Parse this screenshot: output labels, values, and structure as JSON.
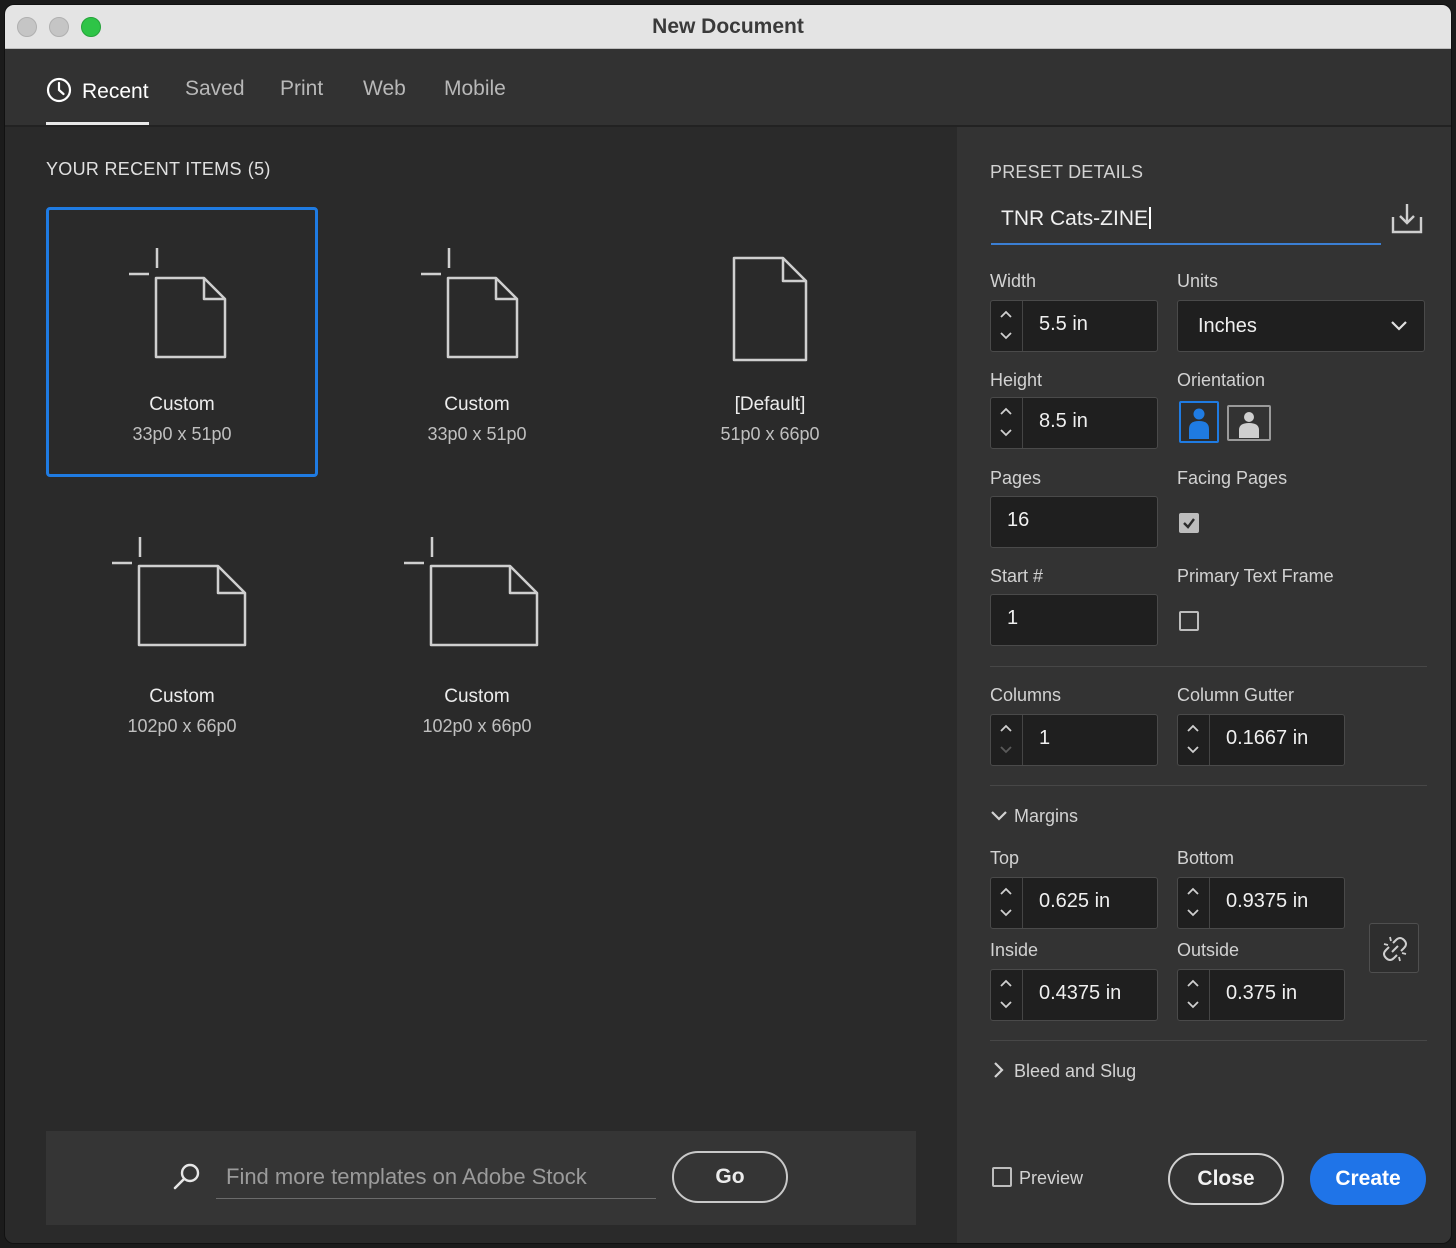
{
  "window": {
    "title": "New Document"
  },
  "tabs": [
    {
      "label": "Recent",
      "active": true,
      "icon": "clock-icon"
    },
    {
      "label": "Saved",
      "active": false
    },
    {
      "label": "Print",
      "active": false
    },
    {
      "label": "Web",
      "active": false
    },
    {
      "label": "Mobile",
      "active": false
    }
  ],
  "recent": {
    "heading": "YOUR RECENT ITEMS",
    "count": "(5)",
    "items": [
      {
        "name": "Custom",
        "dims": "33p0 x 51p0",
        "icon": "portrait-doc-crop-icon",
        "selected": true
      },
      {
        "name": "Custom",
        "dims": "33p0 x 51p0",
        "icon": "portrait-doc-crop-icon",
        "selected": false
      },
      {
        "name": "[Default]",
        "dims": "51p0 x 66p0",
        "icon": "portrait-doc-icon",
        "selected": false
      },
      {
        "name": "Custom",
        "dims": "102p0 x 66p0",
        "icon": "landscape-doc-crop-icon",
        "selected": false
      },
      {
        "name": "Custom",
        "dims": "102p0 x 66p0",
        "icon": "landscape-doc-crop-icon",
        "selected": false
      }
    ]
  },
  "search": {
    "placeholder": "Find more templates on Adobe Stock",
    "go_label": "Go"
  },
  "preset": {
    "heading": "PRESET DETAILS",
    "name": "TNR Cats-ZINE",
    "width_label": "Width",
    "width_value": "5.5 in",
    "units_label": "Units",
    "units_value": "Inches",
    "height_label": "Height",
    "height_value": "8.5 in",
    "orientation_label": "Orientation",
    "orientation_selected": "portrait",
    "pages_label": "Pages",
    "pages_value": "16",
    "facing_label": "Facing Pages",
    "facing_checked": true,
    "start_label": "Start #",
    "start_value": "1",
    "primary_label": "Primary Text Frame",
    "primary_checked": false,
    "columns_label": "Columns",
    "columns_value": "1",
    "gutter_label": "Column Gutter",
    "gutter_value": "0.1667 in",
    "margins_label": "Margins",
    "top_label": "Top",
    "top_value": "0.625 in",
    "bottom_label": "Bottom",
    "bottom_value": "0.9375 in",
    "inside_label": "Inside",
    "inside_value": "0.4375 in",
    "outside_label": "Outside",
    "outside_value": "0.375 in",
    "bleed_label": "Bleed and Slug"
  },
  "footer": {
    "preview_label": "Preview",
    "preview_checked": false,
    "close_label": "Close",
    "create_label": "Create"
  },
  "colors": {
    "accent": "#1f74e8",
    "selection": "#1f7be2"
  }
}
